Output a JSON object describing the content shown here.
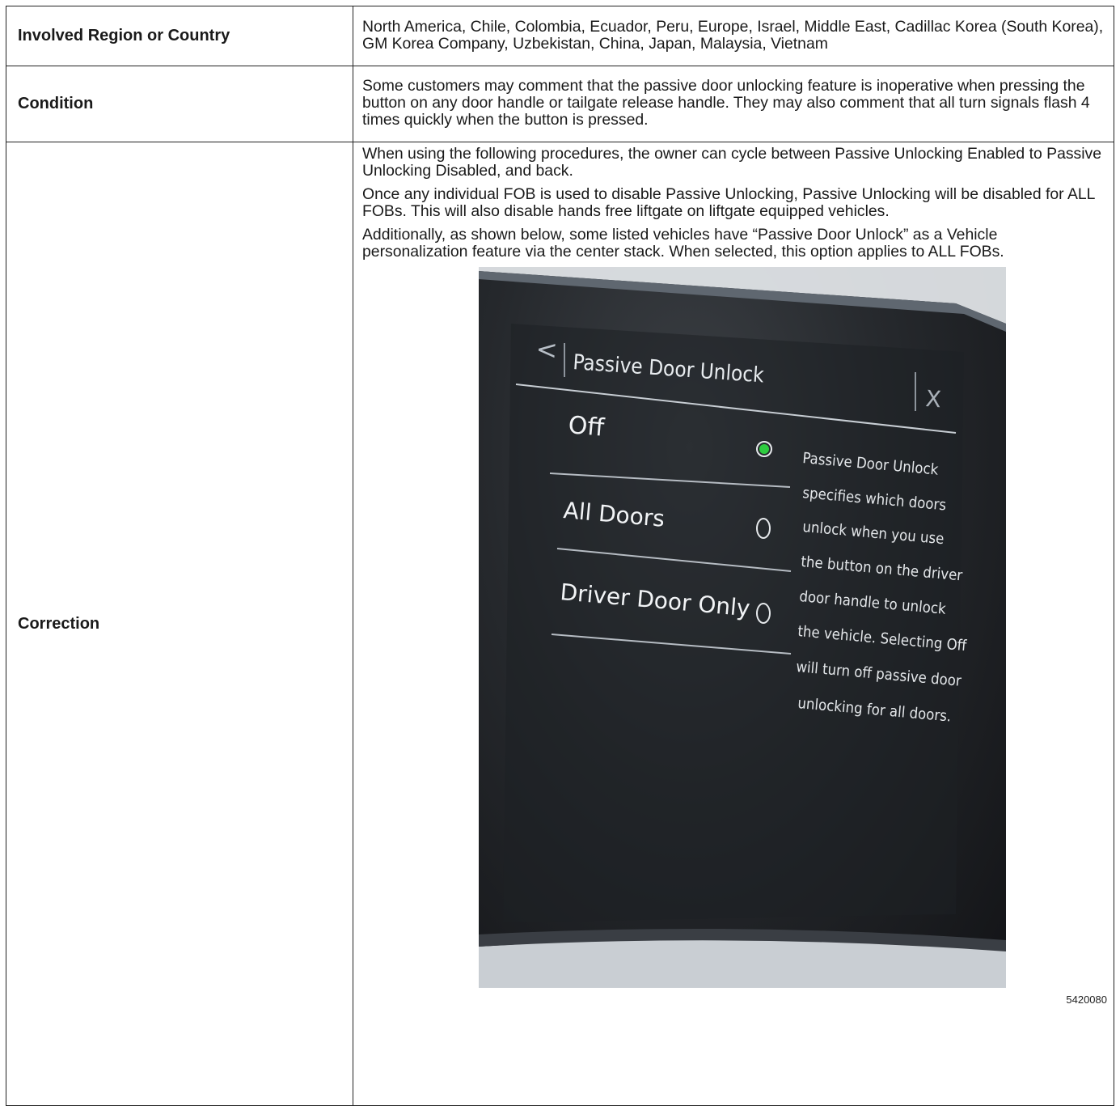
{
  "rows": [
    {
      "label": "Involved Region or Country",
      "content": "North America, Chile, Colombia, Ecuador, Peru, Europe, Israel, Middle East, Cadillac Korea (South Korea), GM Korea Company, Uzbekistan, China, Japan, Malaysia, Vietnam"
    },
    {
      "label": "Condition",
      "content": "Some customers may comment that the passive door unlocking feature is inoperative when pressing the button on any door handle or tailgate release handle. They may also comment that all turn signals flash 4 times quickly when the button is pressed."
    },
    {
      "label": "Correction",
      "paragraphs": [
        "When using the following procedures, the owner can cycle between Passive Unlocking Enabled to Passive Unlocking Disabled, and back.",
        "Once any individual FOB is used to disable Passive Unlocking, Passive Unlocking will be disabled for ALL FOBs. This will also disable hands free liftgate on liftgate equipped vehicles.",
        "Additionally, as shown below, some listed vehicles have “Passive Door Unlock” as a Vehicle personalization feature via the center stack. When selected, this option applies to ALL FOBs."
      ]
    }
  ],
  "screen": {
    "back": "<",
    "title": "Passive Door Unlock",
    "close": "X",
    "options": [
      {
        "label": "Off",
        "selected": true
      },
      {
        "label": "All Doors",
        "selected": false
      },
      {
        "label": "Driver Door Only",
        "selected": false
      }
    ],
    "help_lines": [
      "Passive Door Unlock",
      "specifies which doors",
      "unlock when you use",
      "the button on the driver",
      "door handle to unlock",
      "the vehicle. Selecting Off",
      "will turn off passive door",
      "unlocking for all doors."
    ],
    "selected_color": "#2ecc40"
  },
  "figure_number": "5420080"
}
